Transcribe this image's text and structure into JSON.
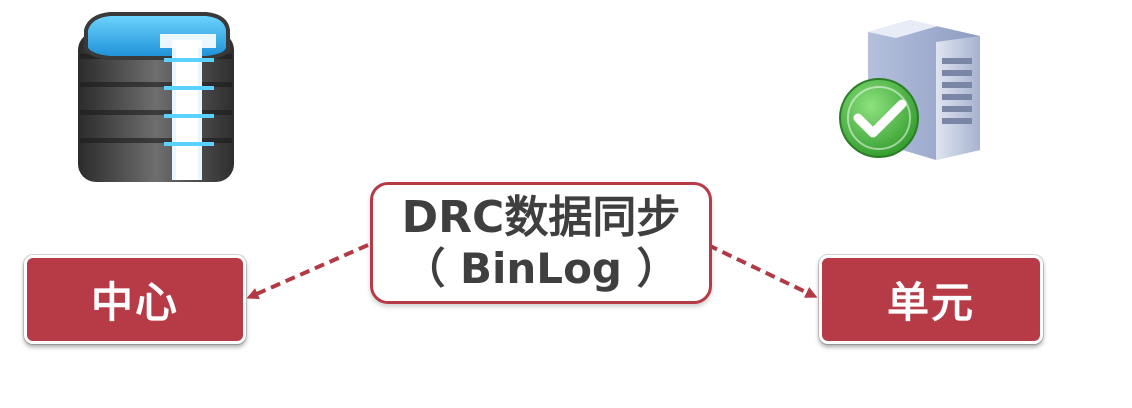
{
  "nodes": {
    "center_label": "中心",
    "unit_label": "单元"
  },
  "sync": {
    "title": "DRC数据同步",
    "subtitle": "（ BinLog ）"
  },
  "icons": {
    "left": "database-server-icon",
    "right": "server-check-icon"
  },
  "colors": {
    "node_fill": "#b73b47",
    "sync_border": "#b73b47",
    "arrow": "#b23a44",
    "text_dark": "#3f3f3f",
    "check_green": "#4fb848",
    "db_blue": "#2fa6e6"
  }
}
